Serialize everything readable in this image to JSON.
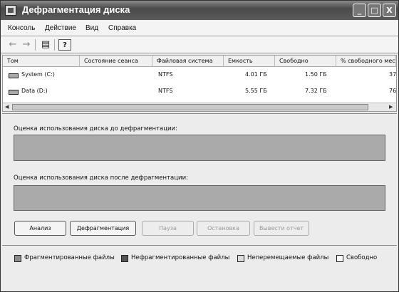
{
  "window": {
    "title": "Дефрагментация диска",
    "controls": [
      "_",
      "□",
      "X"
    ]
  },
  "menu": [
    "Консоль",
    "Действие",
    "Вид",
    "Справка"
  ],
  "toolbar": {
    "back": "←",
    "forward": "→",
    "properties": "▤",
    "help": "?"
  },
  "columns": [
    "Том",
    "Состояние сеанса",
    "Файловая система",
    "Емкость",
    "Свободно",
    "% свободного мес"
  ],
  "volumes": [
    {
      "name": "System (C:)",
      "status": "",
      "fs": "NTFS",
      "capacity": "4.01 ГБ",
      "free": "1.50 ГБ",
      "percent": "37"
    },
    {
      "name": "Data (D:)",
      "status": "",
      "fs": "NTFS",
      "capacity": "5.55 ГБ",
      "free": "7.32 ГБ",
      "percent": "76"
    }
  ],
  "panels": {
    "before": "Оценка использования диска до дефрагментации:",
    "after": "Оценка использования диска после дефрагментации:"
  },
  "buttons": {
    "analyze": "Анализ",
    "defragment": "Дефрагментация",
    "pause": "Пауза",
    "stop": "Остановка",
    "report": "Вывести отчет"
  },
  "legend": [
    {
      "label": "Фрагментированные файлы",
      "color": "#8c8c8c"
    },
    {
      "label": "Нефрагментированные файлы",
      "color": "#555555"
    },
    {
      "label": "Неперемещаемые файлы",
      "color": "#dcdcdc"
    },
    {
      "label": "Свободно",
      "color": "#ffffff"
    }
  ]
}
